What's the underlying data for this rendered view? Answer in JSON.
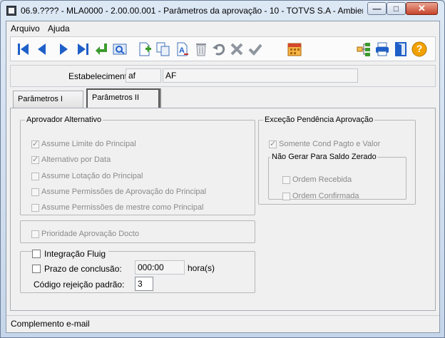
{
  "window": {
    "title": "06.9.???? - MLA0000 - 2.00.00.001 - Parâmetros da aprovação - 10 - TOTVS S.A - Ambiente de ...",
    "min_glyph": "—",
    "max_glyph": "□",
    "close_glyph": "✕"
  },
  "menu": {
    "arquivo": "Arquivo",
    "ajuda": "Ajuda"
  },
  "toolbar": {
    "icons": [
      "first-icon",
      "previous-icon",
      "next-icon",
      "last-icon",
      "go-to-icon",
      "search-icon",
      "new-icon",
      "copy-icon",
      "edit-icon",
      "delete-icon",
      "undo-icon",
      "cancel-icon",
      "save-icon",
      "calendar-icon",
      "tree-icon",
      "print-icon",
      "exit-icon",
      "help-icon"
    ],
    "help_glyph": "?"
  },
  "estabelecimento": {
    "label": "Estabelecimento:",
    "code": "af",
    "name": "AF"
  },
  "tabs": [
    {
      "label": "Parâmetros I"
    },
    {
      "label": "Parâmetros II"
    }
  ],
  "aprovador": {
    "legend": "Aprovador Alternativo",
    "items": [
      {
        "label": "Assume Limite do Principal",
        "checked": true
      },
      {
        "label": "Alternativo por Data",
        "checked": true
      },
      {
        "label": "Assume Lotação do Principal",
        "checked": false
      },
      {
        "label": "Assume Permissões de Aprovação do Principal",
        "checked": false
      },
      {
        "label": "Assume Permissões de mestre como Principal",
        "checked": false
      }
    ]
  },
  "prioridade": {
    "label": "Prioridade Aprovação Docto",
    "checked": false
  },
  "excecao": {
    "legend": "Exceção Pendência Aprovação",
    "somente": {
      "label": "Somente Cond Pagto e Valor",
      "checked": true
    },
    "nao_gerar": {
      "legend": "Não Gerar Para Saldo Zerado",
      "recebida": {
        "label": "Ordem Recebida",
        "checked": false
      },
      "confirmada": {
        "label": "Ordem Confirmada",
        "checked": false
      }
    }
  },
  "fluig": {
    "legend": "Integração Fluig",
    "prazo_label": "Prazo de conclusão:",
    "prazo_value": "000:00",
    "prazo_unit": "hora(s)",
    "codigo_label": "Código rejeição padrão:",
    "codigo_value": "3"
  },
  "status": {
    "text": "Complemento e-mail"
  },
  "colors": {
    "nav_blue": "#1f5fc8",
    "help_orange": "#f2a100",
    "tree_green": "#3c9a2e"
  }
}
